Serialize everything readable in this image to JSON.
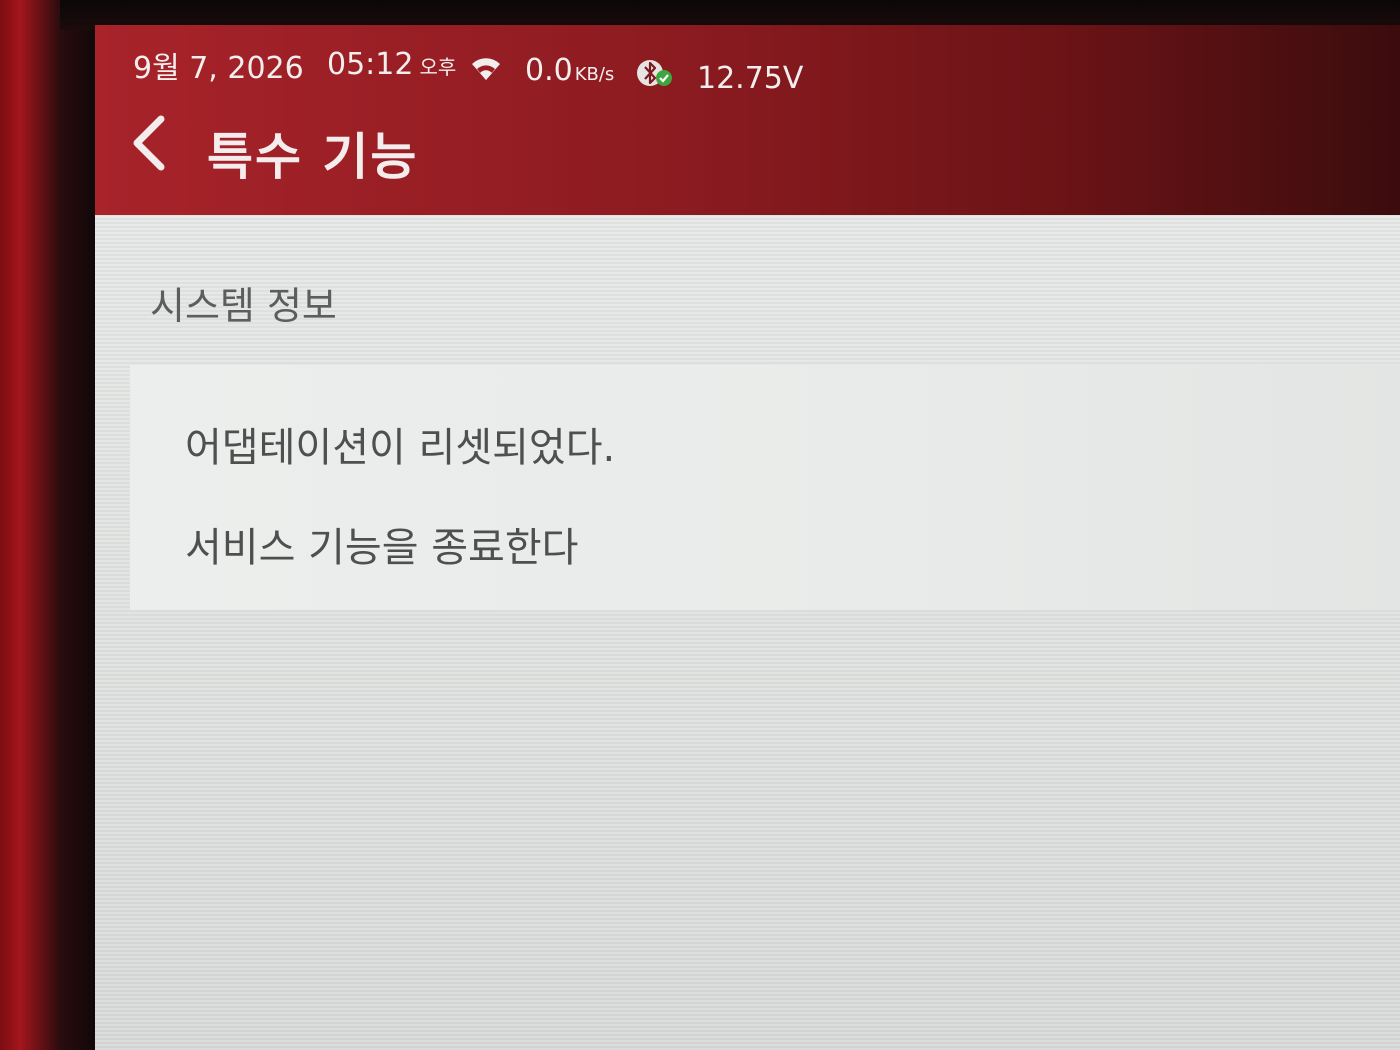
{
  "status_bar": {
    "date": "9월 7, 2026",
    "time": "05:12",
    "ampm": "오후",
    "network_speed": "0.0",
    "network_unit": "KB/s",
    "voltage": "12.75V",
    "icons": [
      "wifi-icon",
      "bluetooth-icon"
    ]
  },
  "header": {
    "back_icon": "chevron-left-icon",
    "title": "특수 기능"
  },
  "section": {
    "title": "시스템 정보",
    "items": [
      {
        "label": "어댑테이션이 리셋되었다."
      },
      {
        "label": "서비스 기능을 종료한다"
      }
    ]
  },
  "colors": {
    "appbar": "#8b1b20",
    "content_bg": "#e2e4e3",
    "text": "#4e504f"
  }
}
